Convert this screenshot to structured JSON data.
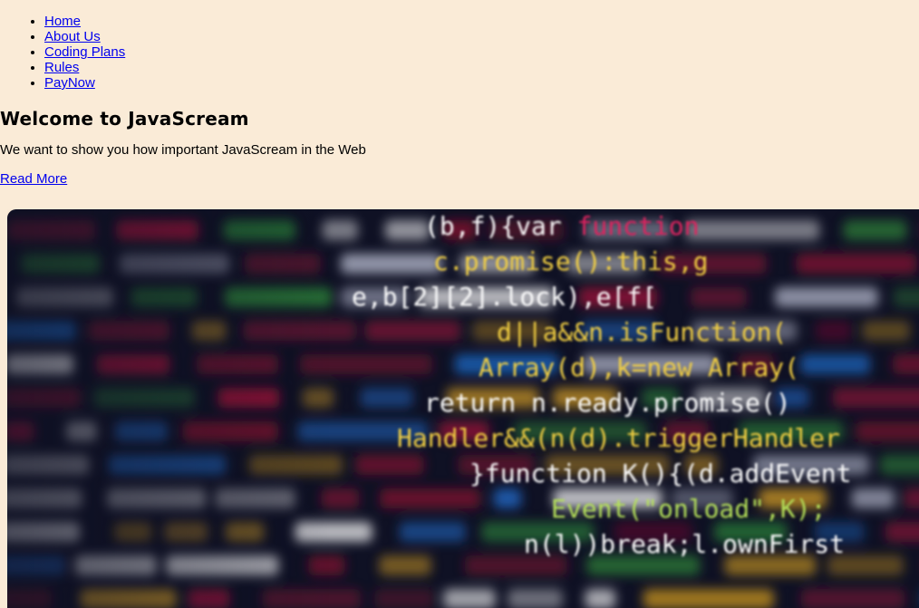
{
  "nav": {
    "items": [
      {
        "label": "Home"
      },
      {
        "label": "About Us"
      },
      {
        "label": "Coding Plans"
      },
      {
        "label": "Rules"
      },
      {
        "label": "PayNow"
      }
    ]
  },
  "hero": {
    "title": "Welcome to JavaScream",
    "text": "We want to show you how important JavaScream in the Web",
    "read_more": "Read More"
  },
  "image": {
    "code_lines": [
      [
        {
          "t": "(b,f){var ",
          "c": "#ffffff"
        },
        {
          "t": "function",
          "c": "#e0245e"
        }
      ],
      [
        {
          "t": "c.promise():this,g",
          "c": "#f5d142"
        }
      ],
      [
        {
          "t": "e,b[2][2].lock),e[f[",
          "c": "#ffffff"
        }
      ],
      [
        {
          "t": "d||a&&n.isFunction(",
          "c": "#f5d142"
        }
      ],
      [
        {
          "t": "Array(d),k=new Array(",
          "c": "#f5d142"
        }
      ],
      [
        {
          "t": "return n.ready.promise()",
          "c": "#ffffff"
        }
      ],
      [
        {
          "t": "Handler&&(n(d).triggerHandler",
          "c": "#f5d142"
        }
      ],
      [
        {
          "t": "}function K(){(d.addEvent",
          "c": "#ffffff"
        }
      ],
      [
        {
          "t": "Event(\"onload\",K);",
          "c": "#b6e25a"
        }
      ],
      [
        {
          "t": "n(l))break;l.ownFirst",
          "c": "#ffffff"
        }
      ]
    ]
  }
}
